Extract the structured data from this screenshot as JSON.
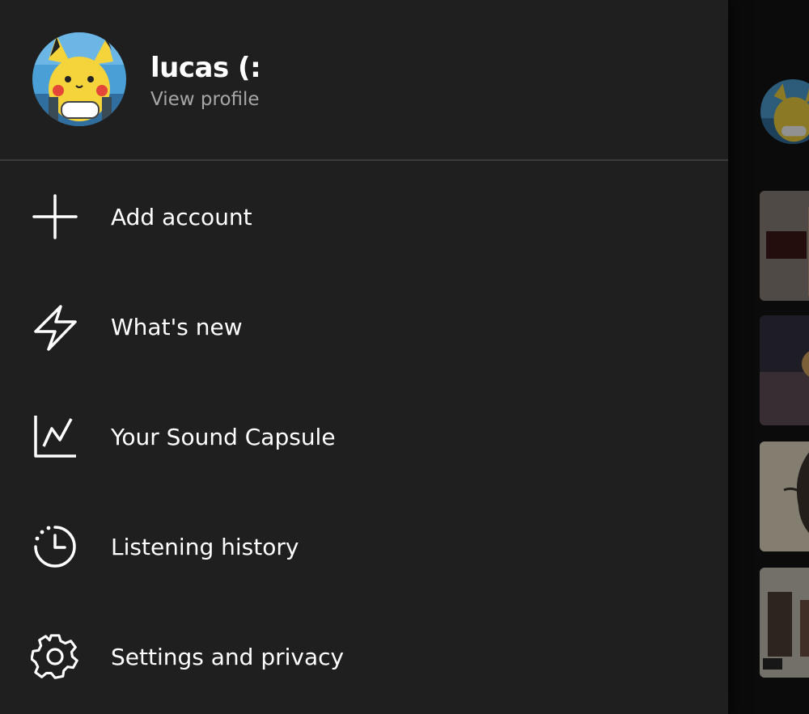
{
  "profile": {
    "name": "lucas (:",
    "subtitle": "View profile"
  },
  "menu": {
    "items": [
      {
        "label": "Add account",
        "icon": "plus-icon"
      },
      {
        "label": "What's new",
        "icon": "lightning-icon"
      },
      {
        "label": "Your Sound Capsule",
        "icon": "chart-icon"
      },
      {
        "label": "Listening history",
        "icon": "history-clock-icon"
      },
      {
        "label": "Settings and privacy",
        "icon": "gear-icon"
      }
    ]
  },
  "colors": {
    "drawer_background": "#1f1f1f",
    "text_primary": "#ffffff",
    "text_secondary": "#a7a7a7",
    "divider": "#3c3c3c",
    "backdrop": "#0b0b0b"
  }
}
